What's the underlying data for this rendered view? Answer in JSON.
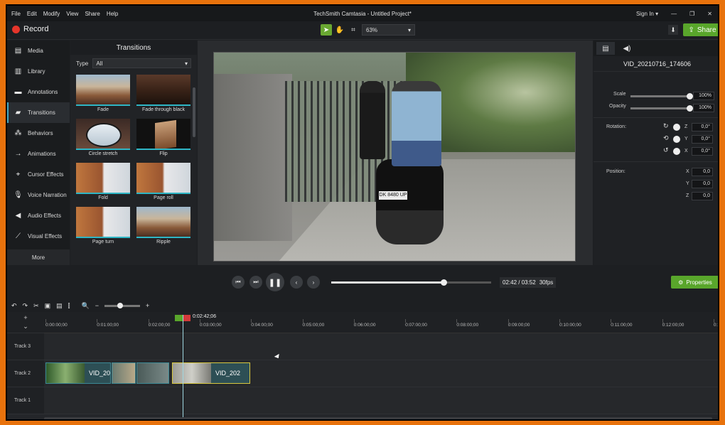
{
  "app": {
    "title": "TechSmith Camtasia - Untitled Project*",
    "menus": [
      "File",
      "Edit",
      "Modify",
      "View",
      "Share",
      "Help"
    ],
    "sign_in": "Sign In ▾",
    "record_label": "Record",
    "zoom": "63%",
    "share_label": "Share",
    "accent_green": "#59a62b",
    "record_red": "#e6352b"
  },
  "sidebar": {
    "items": [
      {
        "label": "Media",
        "icon": "film-icon"
      },
      {
        "label": "Library",
        "icon": "library-icon"
      },
      {
        "label": "Annotations",
        "icon": "annotation-icon"
      },
      {
        "label": "Transitions",
        "icon": "transition-icon"
      },
      {
        "label": "Behaviors",
        "icon": "behaviors-icon"
      },
      {
        "label": "Animations",
        "icon": "animation-icon"
      },
      {
        "label": "Cursor Effects",
        "icon": "cursor-icon"
      },
      {
        "label": "Voice Narration",
        "icon": "microphone-icon"
      },
      {
        "label": "Audio Effects",
        "icon": "speaker-icon"
      },
      {
        "label": "Visual Effects",
        "icon": "wand-icon"
      }
    ],
    "more": "More"
  },
  "transitions": {
    "title": "Transitions",
    "type_label": "Type",
    "type_value": "All",
    "items": [
      "Fade",
      "Fade through black",
      "Circle stretch",
      "Flip",
      "Fold",
      "Page roll",
      "Page turn",
      "Ripple"
    ]
  },
  "properties": {
    "clip_name": "VID_20210716_174606",
    "scale_label": "Scale",
    "scale_value": "100%",
    "scale_level": 1.0,
    "opacity_label": "Opacity",
    "opacity_value": "100%",
    "opacity_level": 1.0,
    "rotation_label": "Rotation:",
    "rot_z": "0,0°",
    "rot_y": "0,0°",
    "rot_x": "0,0°",
    "position_label": "Position:",
    "pos_x": "0,0",
    "pos_y": "0,0",
    "pos_z": "0,0",
    "axis_x": "X",
    "axis_y": "Y",
    "axis_z": "Z"
  },
  "video": {
    "plate": "DK 8480 UP"
  },
  "playback": {
    "time": "02:42 / 03:52",
    "fps": "30fps",
    "progress": 0.7,
    "properties_label": "Properties"
  },
  "timeline": {
    "playhead_time": "0:02:42;06",
    "ruler": [
      "0:00:00;00",
      "0:01:00;00",
      "0:02:00;00",
      "0:03:00;00",
      "0:04:00;00",
      "0:05:00;00",
      "0:06:00;00",
      "0:07:00;00",
      "0:08:00;00",
      "0:09:00;00",
      "0:10:00;00",
      "0:11:00;00",
      "0:12:00;00",
      "0:13:0"
    ],
    "tracks": [
      "Track 3",
      "Track 2",
      "Track 1"
    ],
    "clip_a_name": "VID_20",
    "clip_b_name": "VID_202"
  }
}
